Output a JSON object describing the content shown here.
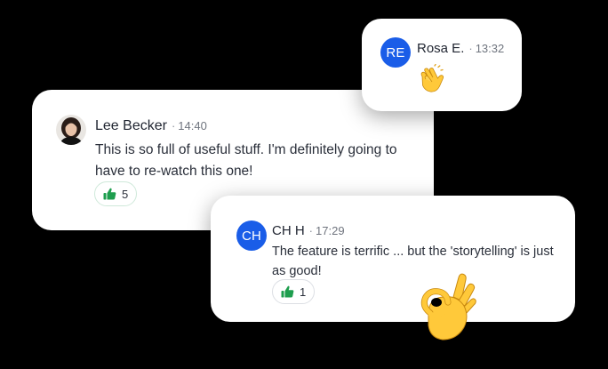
{
  "comments": [
    {
      "id": "lee",
      "author": "Lee Becker",
      "time": "14:40",
      "text": "This is so full of useful stuff. I'm definitely going to have to re-watch this one!",
      "likes": "5"
    },
    {
      "id": "rosa",
      "author": "Rosa E.",
      "initials": "RE",
      "time": "13:32",
      "reaction": "clapping-hands-emoji"
    },
    {
      "id": "chh",
      "author": "CH H",
      "initials": "CH",
      "time": "17:29",
      "text": "The feature is terrific ... but the 'storytelling' is just as good!",
      "likes": "1"
    }
  ],
  "separator": "·",
  "decorations": {
    "ok_hand": "ok-hand-emoji"
  },
  "colors": {
    "avatar_blue": "#1a5de8",
    "like_green": "#1e9e4e",
    "background": "#000000",
    "card": "#ffffff"
  }
}
